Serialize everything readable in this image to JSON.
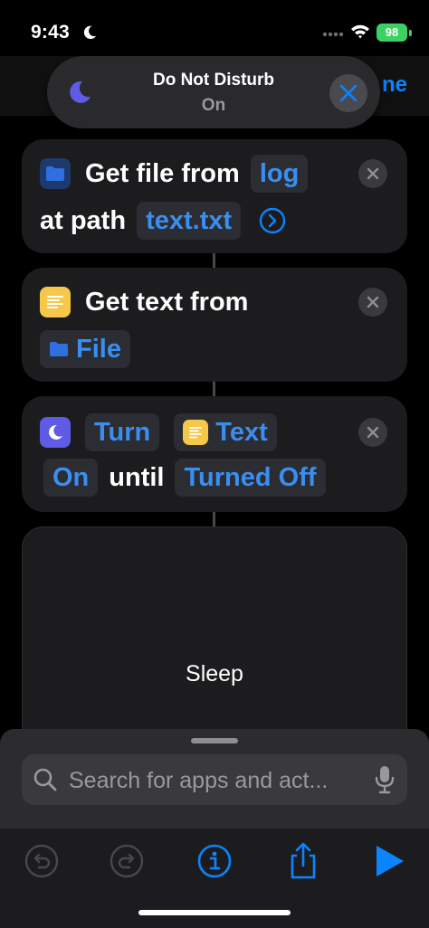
{
  "status_bar": {
    "time": "9:43",
    "battery": "98"
  },
  "nav": {
    "done_partial": "ne"
  },
  "dnd_banner": {
    "title": "Do Not Disturb",
    "subtitle": "On"
  },
  "actions": [
    {
      "line1": {
        "word": "Get file from",
        "token": "log"
      },
      "line2": {
        "word": "at path",
        "token": "text.txt"
      }
    },
    {
      "line1": {
        "word": "Get text from"
      },
      "line2": {
        "token": "File"
      }
    },
    {
      "line1": {
        "token1": "Turn",
        "token2": "Text"
      },
      "line2": {
        "token1": "On",
        "word": "until",
        "token2": "Turned Off"
      }
    }
  ],
  "sleep_card": {
    "label": "Sleep"
  },
  "search": {
    "placeholder": "Search for apps and act..."
  },
  "colors": {
    "accent": "#0a84ff",
    "token_text": "#3a8ef0",
    "files_icon": "#2f6fe0",
    "text_icon": "#f5c84a",
    "focus_icon": "#5e5ce6",
    "battery": "#3bd163"
  },
  "icons": {
    "status_focus": "moon-icon",
    "banner": "moon-icon",
    "toolbar": [
      "undo-icon",
      "redo-icon",
      "info-icon",
      "share-icon",
      "play-icon"
    ]
  }
}
